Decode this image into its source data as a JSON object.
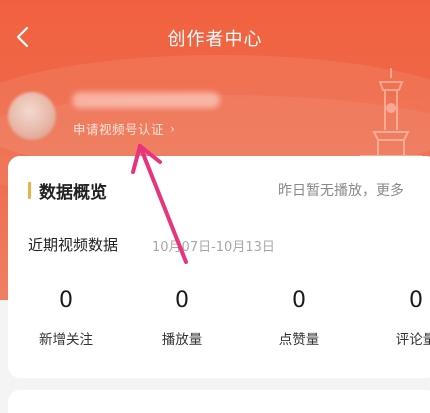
{
  "nav": {
    "title": "创作者中心",
    "back_icon": "chevron-left-icon"
  },
  "profile": {
    "verify_link": "申请视频号认证",
    "verify_chevron": "›"
  },
  "overview": {
    "title": "数据概览",
    "notice": "昨日暂无播放，更多",
    "recent_label": "近期视频数据",
    "date_range": "10月07日-10月13日",
    "stats": [
      {
        "value": "0",
        "label": "新增关注"
      },
      {
        "value": "0",
        "label": "播放量"
      },
      {
        "value": "0",
        "label": "点赞量"
      },
      {
        "value": "0",
        "label": "评论量"
      }
    ]
  },
  "colors": {
    "header_orange": "#f2613f",
    "accent_bar": "#f1b040",
    "annotation_arrow": "#e8347c"
  }
}
